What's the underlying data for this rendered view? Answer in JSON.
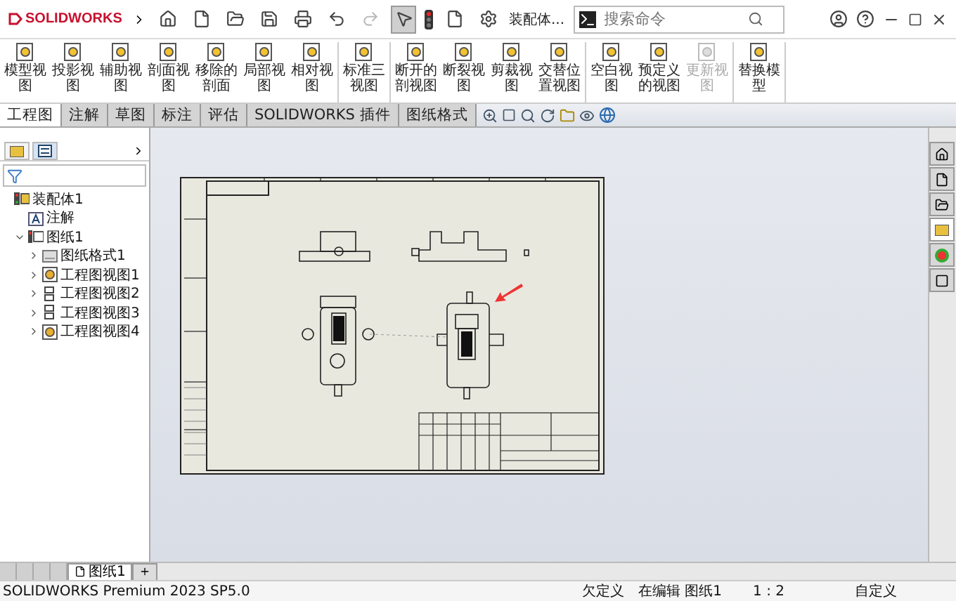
{
  "title_bar": {
    "app_name": "SOLIDWORKS",
    "document": "装配体...",
    "search": {
      "placeholder": "搜索命令"
    }
  },
  "ribbon": {
    "groups": [
      {
        "items": [
          {
            "label": "模型视图",
            "disabled": false
          },
          {
            "label": "投影视图",
            "disabled": false
          },
          {
            "label": "辅助视图",
            "disabled": false
          },
          {
            "label": "剖面视图",
            "disabled": false
          },
          {
            "label": "移除的剖面",
            "disabled": false
          },
          {
            "label": "局部视图",
            "disabled": false
          },
          {
            "label": "相对视图",
            "disabled": false
          }
        ]
      },
      {
        "items": [
          {
            "label": "标准三视图",
            "disabled": false
          }
        ]
      },
      {
        "items": [
          {
            "label": "断开的剖视图",
            "disabled": false
          },
          {
            "label": "断裂视图",
            "disabled": false
          },
          {
            "label": "剪裁视图",
            "disabled": false
          },
          {
            "label": "交替位置视图",
            "disabled": false
          }
        ]
      },
      {
        "items": [
          {
            "label": "空白视图",
            "disabled": false
          },
          {
            "label": "预定义的视图",
            "disabled": false
          },
          {
            "label": "更新视图",
            "disabled": true
          }
        ]
      },
      {
        "items": [
          {
            "label": "替换模型",
            "disabled": false
          }
        ]
      }
    ]
  },
  "tabs": [
    {
      "label": "工程图",
      "selected": true
    },
    {
      "label": "注解",
      "selected": false
    },
    {
      "label": "草图",
      "selected": false
    },
    {
      "label": "标注",
      "selected": false
    },
    {
      "label": "评估",
      "selected": false
    },
    {
      "label": "SOLIDWORKS 插件",
      "selected": false
    },
    {
      "label": "图纸格式",
      "selected": false
    }
  ],
  "sidebar": {
    "panel_tabs": [
      {
        "selected": false
      },
      {
        "selected": true
      }
    ],
    "tree": [
      {
        "label": "装配体1",
        "kind": "assembly",
        "children": [
          {
            "label": "注解",
            "kind": "annotation"
          },
          {
            "label": "图纸1",
            "kind": "sheet",
            "expanded": true,
            "children": [
              {
                "label": "图纸格式1",
                "kind": "format",
                "expanded": false
              },
              {
                "label": "工程图视图1",
                "kind": "part",
                "expanded": false
              },
              {
                "label": "工程图视图2",
                "kind": "view",
                "expanded": false
              },
              {
                "label": "工程图视图3",
                "kind": "view",
                "expanded": false
              },
              {
                "label": "工程图视图4",
                "kind": "part",
                "expanded": false
              }
            ]
          }
        ]
      }
    ]
  },
  "task_pane": [
    {
      "selected": false
    },
    {
      "selected": false
    },
    {
      "selected": false
    },
    {
      "selected": true
    },
    {
      "selected": false
    },
    {
      "selected": false
    }
  ],
  "sheet_tabs": [
    {
      "label": "图纸1",
      "selected": true
    }
  ],
  "status_bar": {
    "product": "SOLIDWORKS Premium 2023 SP5.0",
    "definition": "欠定义",
    "editing": "在编辑 图纸1",
    "scale": "1 : 2",
    "units": "自定义"
  }
}
